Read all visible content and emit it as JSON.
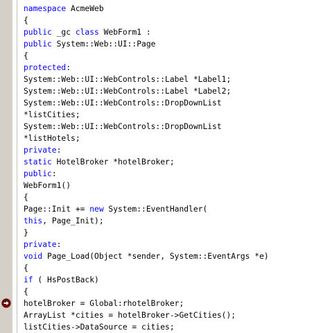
{
  "editor": {
    "breakpoint_icon": "breakpoint-arrow-icon",
    "colors": {
      "keyword": "#0000ff",
      "text": "#000000",
      "margin": "#d4d0c8",
      "breakpoint": "#800000"
    },
    "lines": [
      [
        {
          "t": "namespace",
          "k": true
        },
        {
          "t": " AcmeWeb"
        }
      ],
      [
        {
          "t": "{"
        }
      ],
      [
        {
          "t": "public",
          "k": true
        },
        {
          "t": " _gc "
        },
        {
          "t": "class",
          "k": true
        },
        {
          "t": " WebForm1 :"
        }
      ],
      [
        {
          "t": "public",
          "k": true
        },
        {
          "t": " System::Web::UI::Page"
        }
      ],
      [
        {
          "t": "{"
        }
      ],
      [
        {
          "t": "protected",
          "k": true
        },
        {
          "t": ":"
        }
      ],
      [
        {
          "t": "System::Web::UI::WebControls::Label *Label1;"
        }
      ],
      [
        {
          "t": "System::Web::UI::WebControls::Label *Label2;"
        }
      ],
      [
        {
          "t": "System::Web::UI::WebControls::DropDownList"
        }
      ],
      [
        {
          "t": "*listCities;"
        }
      ],
      [
        {
          "t": "System::Web::UI::WebControls::DropDownList"
        }
      ],
      [
        {
          "t": "*listHotels;"
        }
      ],
      [
        {
          "t": "private",
          "k": true
        },
        {
          "t": ":"
        }
      ],
      [
        {
          "t": "static",
          "k": true
        },
        {
          "t": " HotelBroker *hotelBroker;"
        }
      ],
      [
        {
          "t": "public",
          "k": true
        },
        {
          "t": ":"
        }
      ],
      [
        {
          "t": "WebForm1()"
        }
      ],
      [
        {
          "t": "{"
        }
      ],
      [
        {
          "t": "Page::Init += "
        },
        {
          "t": "new",
          "k": true
        },
        {
          "t": " System::EventHandler("
        }
      ],
      [
        {
          "t": "this",
          "k": true
        },
        {
          "t": ", Page_Init);"
        }
      ],
      [
        {
          "t": "}"
        }
      ],
      [
        {
          "t": "private",
          "k": true
        },
        {
          "t": ":"
        }
      ],
      [
        {
          "t": "void",
          "k": true
        },
        {
          "t": " Page_Load(Object *sender, System::EventArgs *e)"
        }
      ],
      [
        {
          "t": "{"
        }
      ],
      [
        {
          "t": "if",
          "k": true
        },
        {
          "t": " ( HsPostBack)"
        }
      ],
      [
        {
          "t": "{"
        }
      ],
      [
        {
          "t": "hotelBroker = Global:rhotelBroker;"
        }
      ],
      [
        {
          "t": "ArrayList *cities = hotelBroker->GetCities();"
        }
      ],
      [
        {
          "t": "listCities->DataSource = cities;"
        }
      ]
    ],
    "breakpoint_line": 25
  }
}
